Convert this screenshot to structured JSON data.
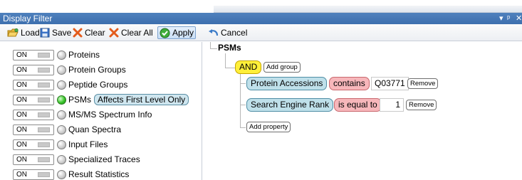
{
  "window": {
    "title": "Display Filter",
    "buttons": [
      "▾",
      "ᵖ",
      "✕"
    ]
  },
  "toolbar": {
    "load_label": "Load",
    "save_label": "Save",
    "clear_label": "Clear",
    "clear_all_label": "Clear All",
    "apply_label": "Apply",
    "cancel_label": "Cancel"
  },
  "levels": [
    {
      "toggle": "ON",
      "label": "Proteins",
      "active": false
    },
    {
      "toggle": "ON",
      "label": "Protein Groups",
      "active": false
    },
    {
      "toggle": "ON",
      "label": "Peptide Groups",
      "active": false
    },
    {
      "toggle": "ON",
      "label": "PSMs",
      "active": true,
      "badge": "Affects First Level Only"
    },
    {
      "toggle": "ON",
      "label": "MS/MS Spectrum Info",
      "active": false
    },
    {
      "toggle": "ON",
      "label": "Quan Spectra",
      "active": false
    },
    {
      "toggle": "ON",
      "label": "Input Files",
      "active": false
    },
    {
      "toggle": "ON",
      "label": "Specialized Traces",
      "active": false
    },
    {
      "toggle": "ON",
      "label": "Result Statistics",
      "active": false
    }
  ],
  "filter": {
    "root": "PSMs",
    "operator": "AND",
    "add_group_label": "Add group",
    "conditions": [
      {
        "property": "Protein Accessions",
        "operator": "contains",
        "value": "Q03771",
        "remove_label": "Remove"
      },
      {
        "property": "Search Engine Rank",
        "operator": "is equal to",
        "value": "1",
        "remove_label": "Remove"
      }
    ],
    "add_property_label": "Add property"
  },
  "colors": {
    "titlebar": "#4f81bd",
    "and_chip": "#ffef3a",
    "property_chip": "#bfe0ea",
    "operator_chip": "#f7b7bb",
    "active_dot": "#38c42a"
  }
}
